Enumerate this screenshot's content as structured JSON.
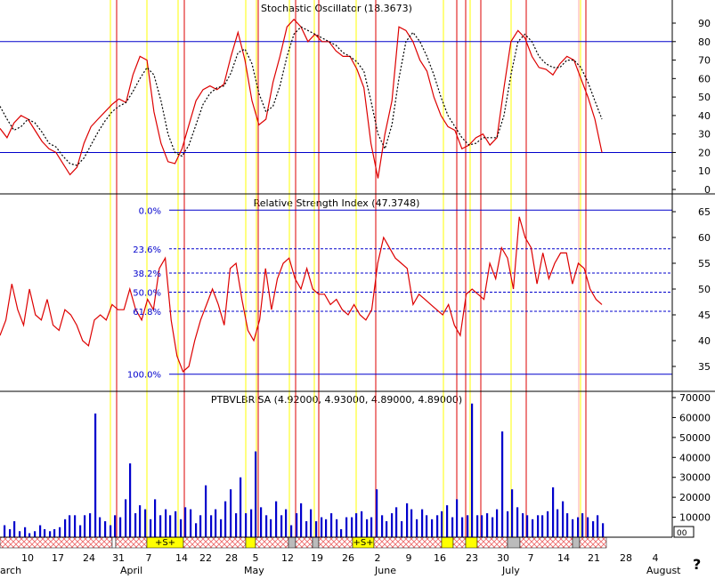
{
  "chart_data": [
    {
      "type": "line",
      "title": "Stochastic Oscillator (18.3673)",
      "ylim": [
        0,
        100
      ],
      "y_ticks": [
        0,
        10,
        20,
        30,
        40,
        50,
        60,
        70,
        80,
        90
      ],
      "reference_lines": [
        20,
        80
      ],
      "series": [
        {
          "style": "solid",
          "color": "#dd0000",
          "values": [
            33,
            28,
            36,
            40,
            38,
            32,
            26,
            22,
            20,
            14,
            8,
            12,
            25,
            34,
            38,
            42,
            46,
            49,
            47,
            62,
            72,
            70,
            42,
            25,
            15,
            14,
            22,
            35,
            48,
            54,
            56,
            54,
            57,
            72,
            85,
            70,
            48,
            35,
            38,
            58,
            72,
            88,
            92,
            88,
            80,
            84,
            80,
            80,
            75,
            72,
            72,
            65,
            55,
            25,
            6,
            30,
            48,
            88,
            86,
            80,
            70,
            64,
            50,
            40,
            34,
            32,
            22,
            24,
            28,
            30,
            24,
            28,
            55,
            80,
            86,
            82,
            72,
            66,
            65,
            62,
            68,
            72,
            70,
            60,
            50,
            38,
            20
          ]
        },
        {
          "style": "dashed",
          "color": "#000000",
          "values": [
            45,
            38,
            32,
            34,
            38,
            36,
            31,
            25,
            23,
            18,
            14,
            13,
            17,
            24,
            31,
            37,
            42,
            45,
            47,
            53,
            60,
            66,
            62,
            48,
            30,
            20,
            18,
            24,
            35,
            46,
            52,
            55,
            56,
            63,
            74,
            76,
            68,
            52,
            42,
            45,
            56,
            72,
            84,
            88,
            86,
            84,
            82,
            80,
            78,
            74,
            72,
            69,
            64,
            48,
            30,
            22,
            35,
            60,
            80,
            85,
            80,
            72,
            62,
            50,
            40,
            34,
            28,
            24,
            25,
            28,
            28,
            28,
            40,
            62,
            80,
            84,
            80,
            72,
            68,
            66,
            66,
            70,
            70,
            66,
            58,
            48,
            38
          ]
        }
      ]
    },
    {
      "type": "line",
      "title": "Relative Strength Index (47.3748)",
      "ylim": [
        31.5,
        67.5
      ],
      "y_ticks": [
        35,
        40,
        45,
        50,
        55,
        60,
        65
      ],
      "fib_levels": [
        {
          "label": "0.0%",
          "value": 65.3,
          "style": "solid"
        },
        {
          "label": "23.6%",
          "value": 57.8,
          "style": "dashed"
        },
        {
          "label": "38.2%",
          "value": 53.1,
          "style": "dashed"
        },
        {
          "label": "50.0%",
          "value": 49.4,
          "style": "dashed"
        },
        {
          "label": "61.8%",
          "value": 45.7,
          "style": "dashed"
        },
        {
          "label": "100.0%",
          "value": 33.5,
          "style": "solid"
        }
      ],
      "series": [
        {
          "style": "solid",
          "color": "#dd0000",
          "values": [
            41,
            44,
            51,
            46,
            43,
            50,
            45,
            44,
            48,
            43,
            42,
            46,
            45,
            43,
            40,
            39,
            44,
            45,
            44,
            47,
            46,
            46,
            50,
            46,
            44,
            48,
            46,
            54,
            56,
            44,
            37,
            34,
            35,
            40,
            44,
            47,
            50,
            47,
            43,
            54,
            55,
            48,
            42,
            40,
            44,
            54,
            46,
            52,
            55,
            56,
            52,
            50,
            54,
            50,
            49,
            49,
            47,
            48,
            46,
            45,
            47,
            45,
            44,
            46,
            55,
            60,
            58,
            56,
            55,
            54,
            47,
            49,
            48,
            47,
            46,
            45,
            47,
            43,
            41,
            49,
            50,
            49,
            48,
            55,
            52,
            58,
            56,
            50,
            64,
            60,
            58,
            51,
            57,
            52,
            55,
            57,
            57,
            51,
            55,
            54,
            50,
            48,
            47
          ]
        }
      ]
    },
    {
      "type": "bar",
      "title": "PTBVLBRISA (4.92000, 4.93000, 4.89000, 4.89000)",
      "ylim": [
        0,
        72000
      ],
      "y_ticks": [
        10000,
        20000,
        30000,
        40000,
        50000,
        60000,
        70000
      ],
      "y_tick_labels": [
        "10000",
        "20000",
        "30000",
        "40000",
        "50000",
        "60000",
        "70000"
      ],
      "values": [
        6000,
        4000,
        8000,
        3000,
        5000,
        2000,
        3000,
        6000,
        4000,
        3000,
        4000,
        5000,
        9000,
        11000,
        11000,
        6000,
        11000,
        12000,
        62000,
        10000,
        8000,
        6000,
        11000,
        10000,
        19000,
        37000,
        12000,
        16000,
        14000,
        9000,
        19000,
        11000,
        14000,
        11000,
        13000,
        9000,
        15000,
        14000,
        7000,
        11000,
        26000,
        11000,
        14000,
        9000,
        18000,
        24000,
        12000,
        30000,
        12000,
        14000,
        43000,
        15000,
        11000,
        9000,
        18000,
        11000,
        14000,
        6000,
        12000,
        17000,
        8000,
        14000,
        8000,
        10000,
        9000,
        12000,
        9000,
        4000,
        10000,
        10000,
        12000,
        13000,
        9000,
        10000,
        24000,
        11000,
        8000,
        12000,
        15000,
        8000,
        17000,
        14000,
        9000,
        14000,
        11000,
        9000,
        11000,
        13000,
        16000,
        10000,
        19000,
        10000,
        11000,
        67000,
        11000,
        11000,
        12000,
        10000,
        14000,
        53000,
        13000,
        24000,
        15000,
        12000,
        11000,
        9000,
        11000,
        11000,
        13000,
        25000,
        14000,
        18000,
        12000,
        9000,
        10000,
        12000,
        10000,
        8000,
        11000,
        7000
      ]
    }
  ],
  "bands": [
    {
      "type": "cross",
      "value": "",
      "c": "#ff9999"
    },
    {
      "type": "plain",
      "value": "",
      "c": "#ffffff"
    },
    {
      "type": "cross",
      "value": "",
      "c": "#ff9999"
    },
    {
      "type": "yellow",
      "value": "+S+",
      "c": "#ffff00"
    },
    {
      "type": "cross",
      "value": "",
      "c": "#ff9999"
    },
    {
      "type": "yellow",
      "value": "",
      "c": "#ffff00"
    },
    {
      "type": "cross",
      "value": "",
      "c": "#ff9999"
    },
    {
      "type": "gray",
      "value": "",
      "c": "#bbbbbb"
    },
    {
      "type": "cross",
      "value": "",
      "c": "#ff9999"
    },
    {
      "type": "gray",
      "value": "",
      "c": "#bbbbbb"
    },
    {
      "type": "cross",
      "value": "",
      "c": "#ff9999"
    },
    {
      "type": "yellow",
      "value": "+S+",
      "c": "#ffff00"
    },
    {
      "type": "cross",
      "value": "",
      "c": "#ff9999"
    },
    {
      "type": "yellow",
      "value": "",
      "c": "#ffff00"
    },
    {
      "type": "cross",
      "value": "",
      "c": "#ff9999"
    },
    {
      "type": "yellow",
      "value": "",
      "c": "#ffff00"
    },
    {
      "type": "cross",
      "value": "",
      "c": "#ff9999"
    },
    {
      "type": "gray",
      "value": "",
      "c": "#bbbbbb"
    },
    {
      "type": "cross",
      "value": "",
      "c": "#ff9999"
    },
    {
      "type": "gray",
      "value": "",
      "c": "#bbbbbb"
    },
    {
      "type": "cross",
      "value": "",
      "c": "#ff9999"
    }
  ],
  "x_axis": {
    "days": [
      "10",
      "17",
      "24",
      "31",
      "7",
      "14",
      "22",
      "28",
      "5",
      "12",
      "19",
      "26",
      "2",
      "9",
      "16",
      "23",
      "30",
      "7",
      "14",
      "21",
      "28",
      "4"
    ],
    "months": [
      "arch",
      "April",
      "May",
      "June",
      "July",
      "August"
    ],
    "help_symbol": "?",
    "scroll_marker": "00"
  },
  "colors": {
    "red_marker": "#dd0000",
    "yellow_marker": "#ffff00",
    "pink_marker": "#ffaaaa",
    "guide_blue": "#0000cc",
    "volume_blue": "#0000cc"
  }
}
